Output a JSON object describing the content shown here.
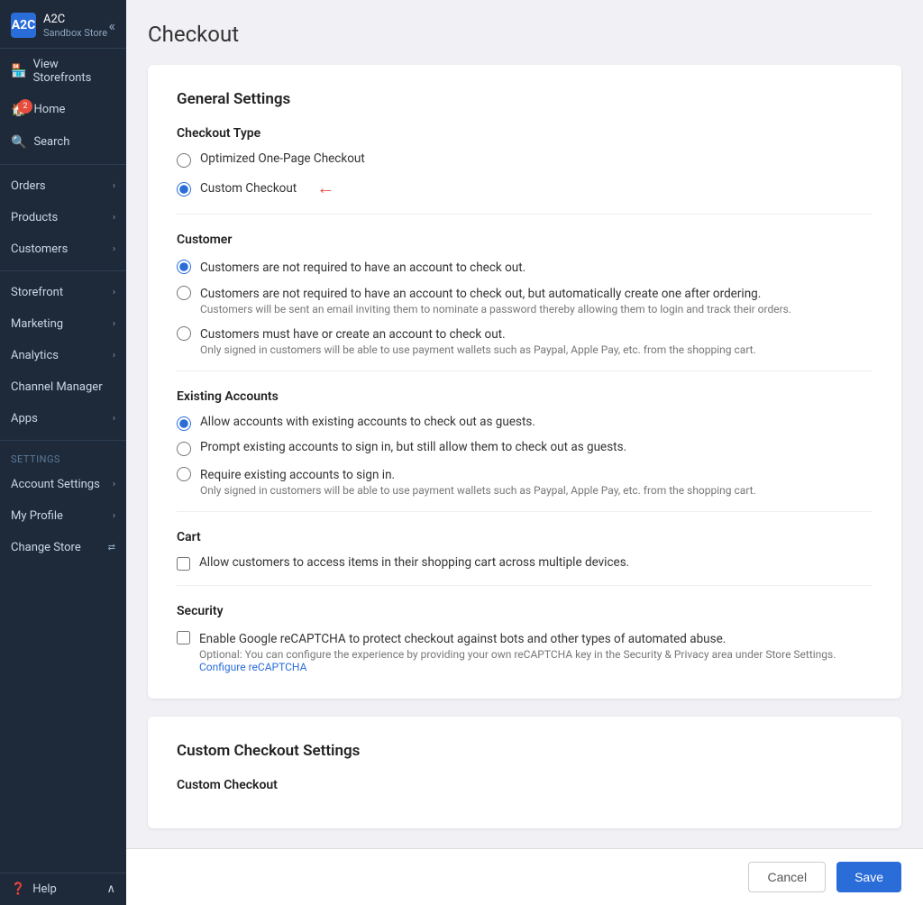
{
  "sidebar": {
    "logo_text": "A2C",
    "store_name": "Sandbox Store",
    "collapse_icon": "«",
    "nav_items": [
      {
        "id": "view-storefronts",
        "label": "View Storefronts",
        "icon": "🏪",
        "badge": null,
        "chevron": false
      },
      {
        "id": "home",
        "label": "Home",
        "icon": "🏠",
        "badge": "2",
        "chevron": false
      },
      {
        "id": "search",
        "label": "Search",
        "icon": "🔍",
        "badge": null,
        "chevron": false
      },
      {
        "id": "orders",
        "label": "Orders",
        "icon": "",
        "badge": null,
        "chevron": true
      },
      {
        "id": "products",
        "label": "Products",
        "icon": "",
        "badge": null,
        "chevron": true
      },
      {
        "id": "customers",
        "label": "Customers",
        "icon": "",
        "badge": null,
        "chevron": true
      },
      {
        "id": "storefront",
        "label": "Storefront",
        "icon": "",
        "badge": null,
        "chevron": true
      },
      {
        "id": "marketing",
        "label": "Marketing",
        "icon": "",
        "badge": null,
        "chevron": true
      },
      {
        "id": "analytics",
        "label": "Analytics",
        "icon": "",
        "badge": null,
        "chevron": true
      },
      {
        "id": "channel-manager",
        "label": "Channel Manager",
        "icon": "",
        "badge": null,
        "chevron": false
      },
      {
        "id": "apps",
        "label": "Apps",
        "icon": "",
        "badge": null,
        "chevron": true
      }
    ],
    "settings_label": "Settings",
    "settings_items": [
      {
        "id": "account-settings",
        "label": "Account Settings",
        "icon": "",
        "chevron": true
      },
      {
        "id": "my-profile",
        "label": "My Profile",
        "icon": "",
        "chevron": true
      },
      {
        "id": "change-store",
        "label": "Change Store",
        "icon": "",
        "chevron": false,
        "special_icon": "⇄"
      }
    ],
    "footer_label": "Help"
  },
  "page": {
    "title": "Checkout",
    "general_settings": {
      "heading": "General Settings",
      "checkout_type": {
        "heading": "Checkout Type",
        "options": [
          {
            "id": "optimized",
            "label": "Optimized One-Page Checkout",
            "checked": false,
            "arrow": false
          },
          {
            "id": "custom",
            "label": "Custom Checkout",
            "checked": true,
            "arrow": true
          }
        ]
      },
      "customer": {
        "heading": "Customer",
        "options": [
          {
            "id": "not-required",
            "label": "Customers are not required to have an account to check out.",
            "sublabel": "",
            "checked": true
          },
          {
            "id": "auto-create",
            "label": "Customers are not required to have an account to check out, but automatically create one after ordering.",
            "sublabel": "Customers will be sent an email inviting them to nominate a password thereby allowing them to login and track their orders.",
            "checked": false
          },
          {
            "id": "must-have",
            "label": "Customers must have or create an account to check out.",
            "sublabel": "Only signed in customers will be able to use payment wallets such as Paypal, Apple Pay, etc. from the shopping cart.",
            "checked": false
          }
        ]
      },
      "existing_accounts": {
        "heading": "Existing Accounts",
        "options": [
          {
            "id": "allow-guest",
            "label": "Allow accounts with existing accounts to check out as guests.",
            "checked": true
          },
          {
            "id": "prompt-signin",
            "label": "Prompt existing accounts to sign in, but still allow them to check out as guests.",
            "checked": false
          },
          {
            "id": "require-signin",
            "label": "Require existing accounts to sign in.",
            "sublabel": "Only signed in customers will be able to use payment wallets such as Paypal, Apple Pay, etc. from the shopping cart.",
            "checked": false
          }
        ]
      },
      "cart": {
        "heading": "Cart",
        "options": [
          {
            "id": "cart-multi-device",
            "label": "Allow customers to access items in their shopping cart across multiple devices.",
            "checked": false
          }
        ]
      },
      "security": {
        "heading": "Security",
        "options": [
          {
            "id": "recaptcha",
            "label": "Enable Google reCAPTCHA to protect checkout against bots and other types of automated abuse.",
            "sublabel": "Optional: You can configure the experience by providing your own reCAPTCHA key in the Security & Privacy area under Store Settings.",
            "checked": false
          }
        ],
        "configure_link_text": "Configure reCAPTCHA",
        "configure_link_href": "#"
      }
    },
    "custom_checkout_settings": {
      "heading": "Custom Checkout Settings",
      "custom_checkout_label": "Custom Checkout"
    },
    "footer": {
      "cancel_label": "Cancel",
      "save_label": "Save"
    }
  }
}
